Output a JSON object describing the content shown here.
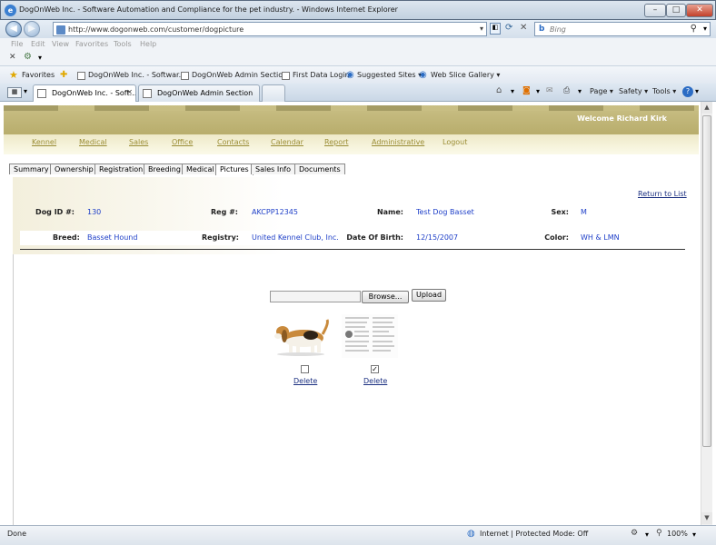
{
  "window": {
    "title": "DogOnWeb Inc. - Software Automation and Compliance for the pet industry. - Windows Internet Explorer",
    "min": "–",
    "max": "□",
    "close": "✕"
  },
  "address": {
    "url": "http://www.dogonweb.com/customer/dogpicture",
    "search_placeholder": "Bing"
  },
  "menu": [
    "File",
    "Edit",
    "View",
    "Favorites",
    "Tools",
    "Help"
  ],
  "favorites_bar": {
    "favorites": "Favorites",
    "items": [
      "DogOnWeb Inc. - Softwar...",
      "DogOnWeb Admin Section",
      "First Data Login",
      "Suggested Sites ▾",
      "Web Slice Gallery ▾"
    ]
  },
  "browser_tabs": [
    "DogOnWeb Inc. - Soft...",
    "DogOnWeb Admin Section"
  ],
  "commands": [
    "Page ▾",
    "Safety ▾",
    "Tools ▾"
  ],
  "site": {
    "welcome": "Welcome Richard Kirk",
    "nav": [
      "Kennel",
      "Medical",
      "Sales",
      "Office",
      "Contacts",
      "Calendar",
      "Report",
      "Administrative",
      "Logout"
    ]
  },
  "page_tabs": [
    "Summary",
    "Ownership",
    "Registration",
    "Breeding",
    "Medical",
    "Pictures",
    "Sales Info",
    "Documents"
  ],
  "active_tab": "Pictures",
  "return_link": "Return to List",
  "dog": {
    "id_label": "Dog ID #:",
    "id": "130",
    "reg_label": "Reg #:",
    "reg": "AKCPP12345",
    "name_label": "Name:",
    "name": "Test Dog Basset",
    "sex_label": "Sex:",
    "sex": "M",
    "breed_label": "Breed:",
    "breed": "Basset Hound",
    "registry_label": "Registry:",
    "registry": "United Kennel Club, Inc.",
    "dob_label": "Date Of Birth:",
    "dob": "12/15/2007",
    "color_label": "Color:",
    "color": "WH & LMN"
  },
  "upload": {
    "browse": "Browse...",
    "upload": "Upload"
  },
  "pictures": [
    {
      "checked": false,
      "delete": "Delete"
    },
    {
      "checked": true,
      "delete": "Delete"
    }
  ],
  "status": {
    "left": "Done",
    "zone": "Internet | Protected Mode: Off",
    "zoom": "100%"
  },
  "colors": {
    "accent": "#9b8d36",
    "link": "#1e3fc8",
    "banner": "#c9bf85"
  }
}
